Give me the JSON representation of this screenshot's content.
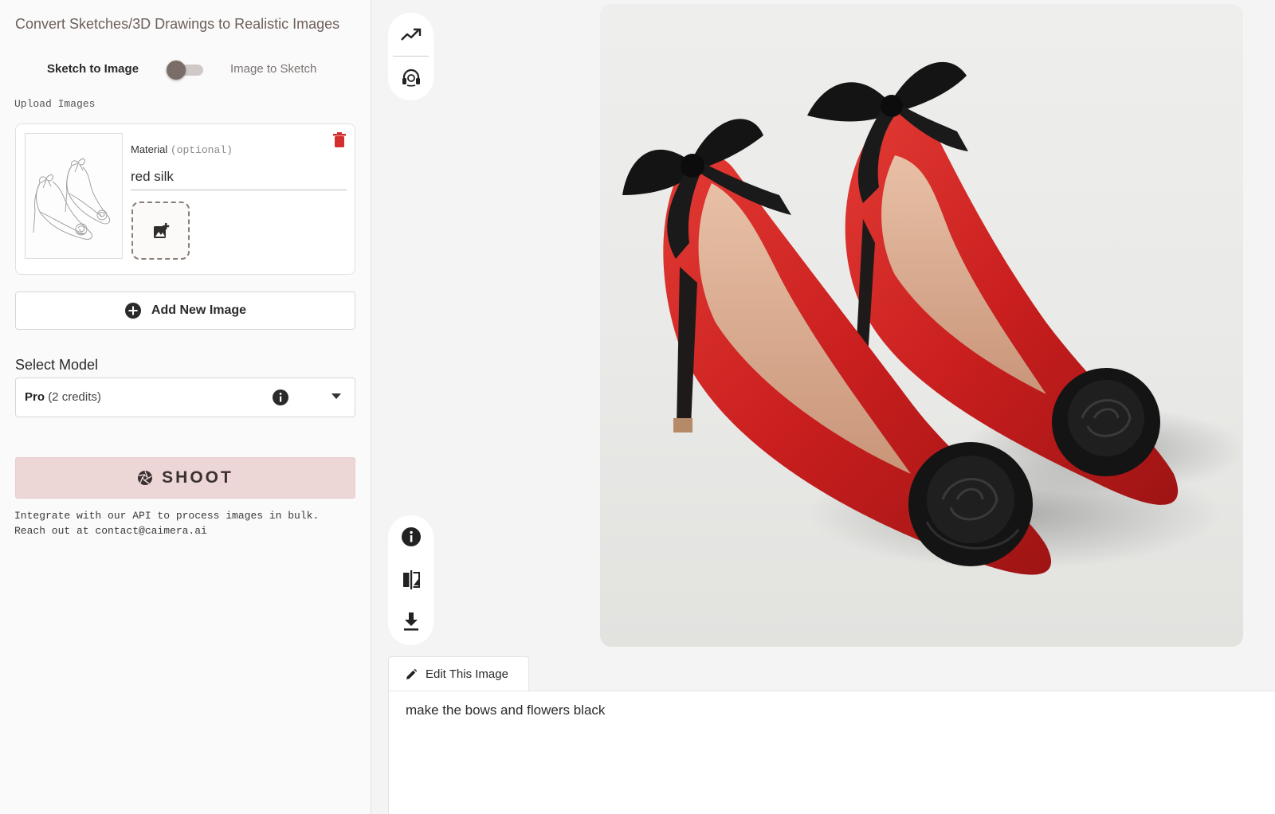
{
  "sidebar": {
    "title": "Convert Sketches/3D Drawings to Realistic Images",
    "mode_toggle": {
      "left_label": "Sketch to Image",
      "right_label": "Image to Sketch",
      "selected": "Sketch to Image"
    },
    "upload_label": "Upload Images",
    "upload_card": {
      "material_label": "Material",
      "material_optional": "(optional)",
      "material_value": "red silk"
    },
    "add_image_label": "Add New Image",
    "select_model_label": "Select Model",
    "model": {
      "name": "Pro",
      "credits": "(2 credits)"
    },
    "shoot_label": "SHOOT",
    "api_note_line1": "Integrate with our API to process images in bulk.",
    "api_note_line2": "Reach out at contact@caimera.ai"
  },
  "main": {
    "edit_tab_label": "Edit This Image",
    "edit_prompt": "make the bows and flowers black"
  },
  "icons": {
    "toolbar_top": [
      "trend-icon",
      "support-icon"
    ],
    "toolbar_bottom": [
      "info-icon",
      "compare-icon",
      "download-icon"
    ],
    "upload_card": [
      "trash-icon",
      "add-photo-icon"
    ]
  },
  "colors": {
    "accent_text": "#6e5f5a",
    "shoot_bg": "#ecd6d6",
    "trash": "#d32f2f",
    "toggle_knob": "#7a6c67"
  }
}
